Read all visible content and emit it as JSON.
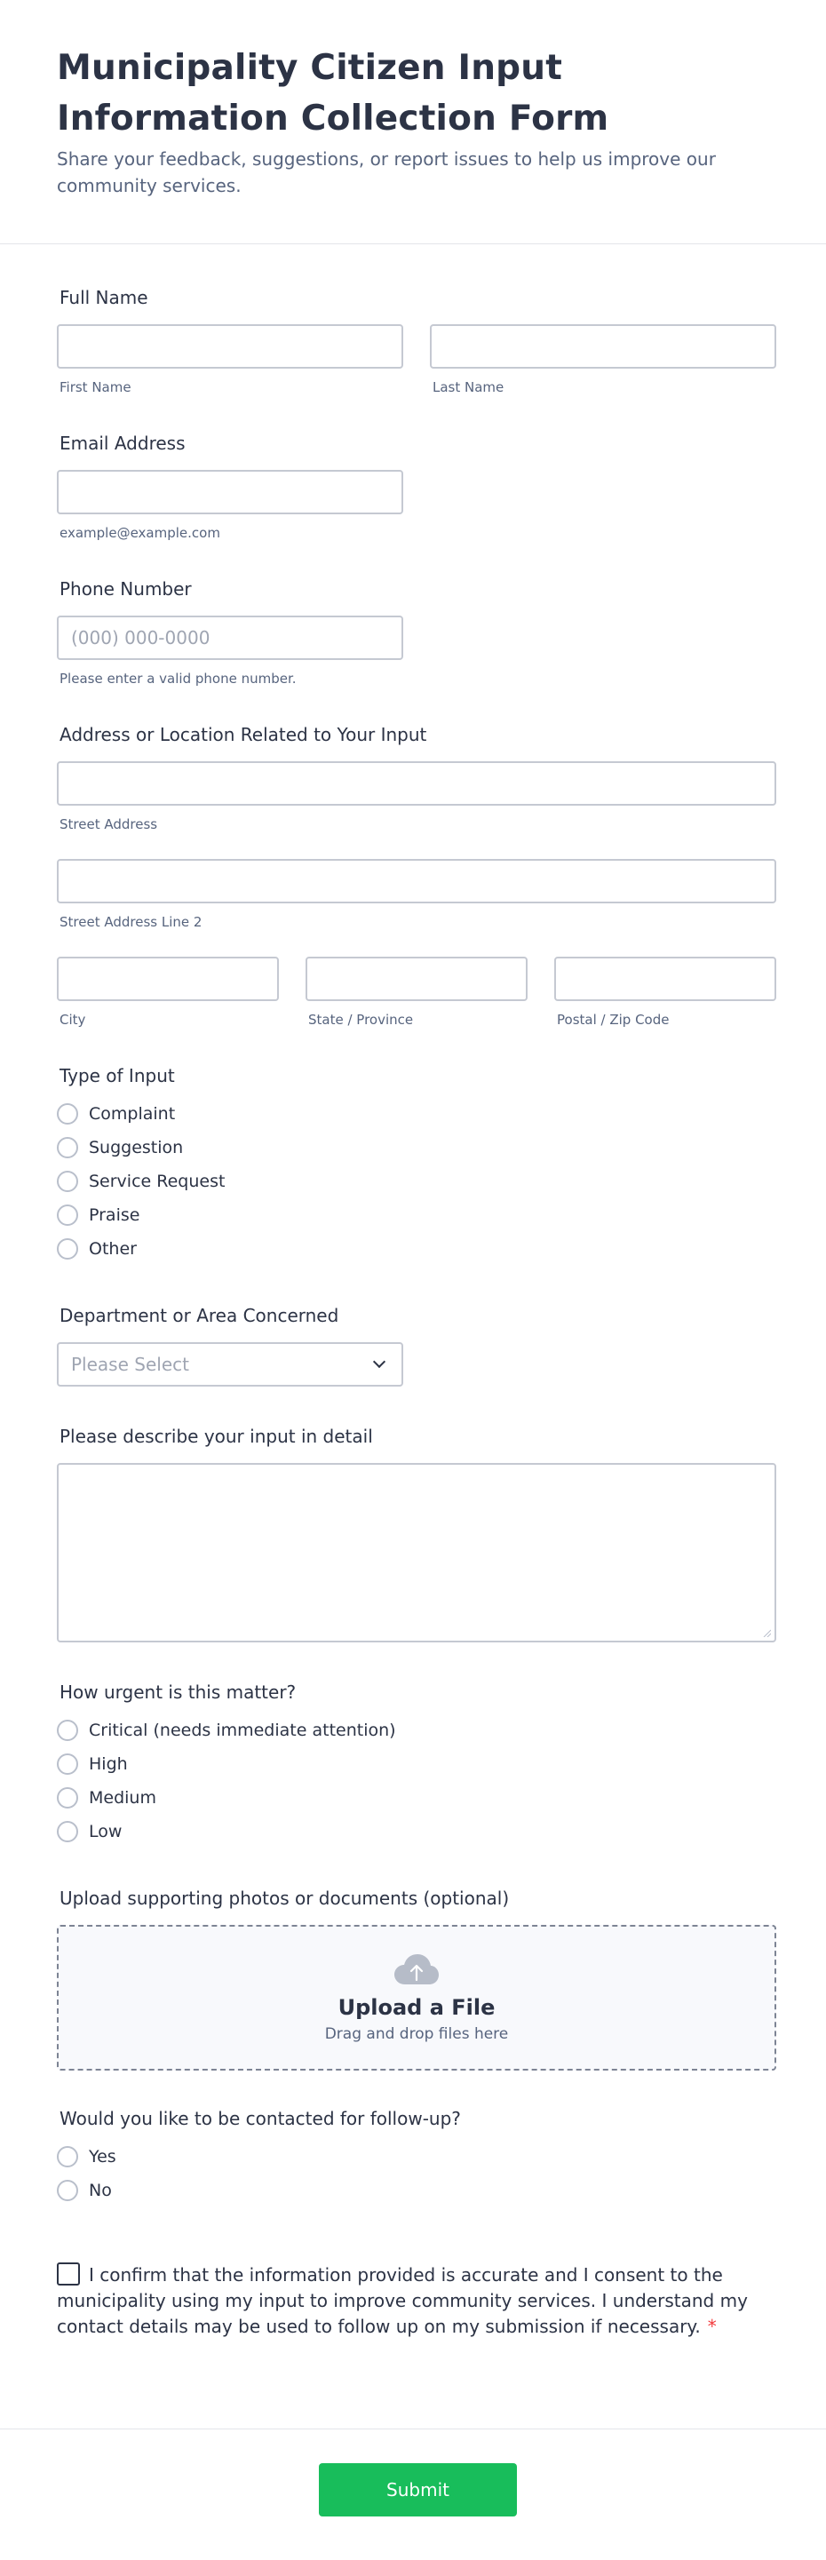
{
  "header": {
    "title": "Municipality Citizen Input Information Collection Form",
    "subtitle": "Share your feedback, suggestions, or report issues to help us improve our community services."
  },
  "full_name": {
    "label": "Full Name",
    "first_sub": "First Name",
    "last_sub": "Last Name"
  },
  "email": {
    "label": "Email Address",
    "sub": "example@example.com"
  },
  "phone": {
    "label": "Phone Number",
    "placeholder": "(000) 000-0000",
    "sub": "Please enter a valid phone number."
  },
  "address": {
    "label": "Address or Location Related to Your Input",
    "street_sub": "Street Address",
    "street2_sub": "Street Address Line 2",
    "city_sub": "City",
    "state_sub": "State / Province",
    "zip_sub": "Postal / Zip Code"
  },
  "input_type": {
    "label": "Type of Input",
    "options": [
      "Complaint",
      "Suggestion",
      "Service Request",
      "Praise",
      "Other"
    ]
  },
  "department": {
    "label": "Department or Area Concerned",
    "placeholder": "Please Select"
  },
  "details": {
    "label": "Please describe your input in detail"
  },
  "urgency": {
    "label": "How urgent is this matter?",
    "options": [
      "Critical (needs immediate attention)",
      "High",
      "Medium",
      "Low"
    ]
  },
  "upload": {
    "label": "Upload supporting photos or documents (optional)",
    "title": "Upload a File",
    "sub": "Drag and drop files here",
    "icon": "cloud-upload-icon"
  },
  "followup": {
    "label": "Would you like to be contacted for follow-up?",
    "options": [
      "Yes",
      "No"
    ]
  },
  "consent": {
    "text": "I confirm that the information provided is accurate and I consent to the municipality using my input to improve community services. I understand my contact details may be used to follow up on my submission if necessary.",
    "required_mark": "*"
  },
  "submit_label": "Submit",
  "colors": {
    "accent": "#18bd5b",
    "required": "#f23a3c",
    "text": "#2c3345",
    "muted": "#57647e"
  }
}
